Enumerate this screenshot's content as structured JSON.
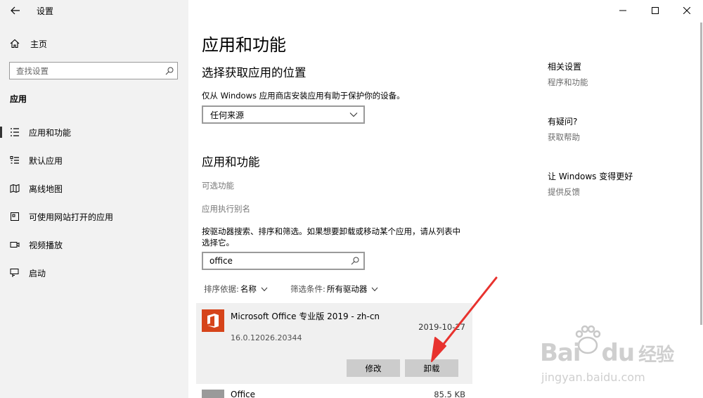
{
  "window": {
    "title": "设置",
    "controls": [
      "minimize-icon",
      "maximize-icon",
      "close-icon"
    ]
  },
  "sidebar": {
    "home_label": "主页",
    "search_placeholder": "查找设置",
    "section_label": "应用",
    "items": [
      {
        "label": "应用和功能",
        "icon": "apps-features-icon",
        "active": true
      },
      {
        "label": "默认应用",
        "icon": "default-apps-icon",
        "active": false
      },
      {
        "label": "离线地图",
        "icon": "offline-maps-icon",
        "active": false
      },
      {
        "label": "可使用网站打开的应用",
        "icon": "apps-for-websites-icon",
        "active": false
      },
      {
        "label": "视频播放",
        "icon": "video-playback-icon",
        "active": false
      },
      {
        "label": "启动",
        "icon": "startup-icon",
        "active": false
      }
    ]
  },
  "main": {
    "title": "应用和功能",
    "install_section": {
      "heading": "选择获取应用的位置",
      "description": "仅从 Windows 应用商店安装应用有助于保护你的设备。",
      "dropdown_value": "任何来源"
    },
    "apps_section": {
      "heading": "应用和功能",
      "optional_features": "可选功能",
      "app_aliases": "应用执行别名",
      "instructions_line1": "按驱动器搜索、排序和筛选。如果想要卸载或移动某个应用，请从列表中",
      "instructions_line2": "选择它。",
      "search_value": "office",
      "sort_key": "排序依据:",
      "sort_value": "名称",
      "filter_key": "筛选条件:",
      "filter_value": "所有驱动器"
    },
    "apps": [
      {
        "name": "Microsoft Office 专业版 2019 - zh-cn",
        "date": "2019-10-27",
        "version": "16.0.12026.20344",
        "modify_label": "修改",
        "uninstall_label": "卸载"
      },
      {
        "name": "Office",
        "size": "85.5 KB"
      }
    ]
  },
  "related": {
    "related_title": "相关设置",
    "related_link": "程序和功能",
    "help_title": "有疑问?",
    "help_link": "获取帮助",
    "feedback_title": "让 Windows 变得更好",
    "feedback_link": "提供反馈"
  },
  "watermark": {
    "brand": "Bai",
    "brand2": "du",
    "cn": "经验",
    "url": "jingyan.baidu.com"
  },
  "colors": {
    "sidebar_bg": "#f2f2f2",
    "office_orange": "#d6441a",
    "annotation_red": "#e8322e",
    "button_bg": "#cccccc"
  }
}
